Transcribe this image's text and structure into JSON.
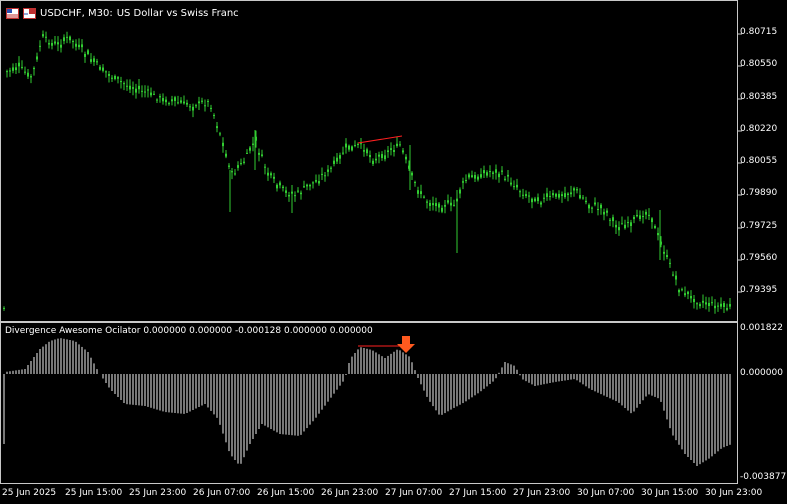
{
  "header": {
    "symbol_label": "USDCHF, M30:",
    "description": "US Dollar vs Swiss Franc",
    "icons": [
      "flag-icon",
      "chart-type-icon"
    ]
  },
  "price_axis": {
    "labels": [
      "0.80715",
      "0.80550",
      "0.80385",
      "0.80220",
      "0.80055",
      "0.79890",
      "0.79725",
      "0.79560",
      "0.79395"
    ]
  },
  "indicator": {
    "title": "Divergence Awesome Ocilator 0.000000 0.000000 -0.000128 0.000000 0.000000",
    "axis_labels": [
      "0.001822",
      "0.000000",
      "-0.003877"
    ]
  },
  "time_axis": {
    "labels": [
      "25 Jun 2025",
      "25 Jun 15:00",
      "25 Jun 23:00",
      "26 Jun 07:00",
      "26 Jun 15:00",
      "26 Jun 23:00",
      "27 Jun 07:00",
      "27 Jun 15:00",
      "27 Jun 23:00",
      "30 Jun 07:00",
      "30 Jun 15:00",
      "30 Jun 23:00"
    ]
  },
  "colors": {
    "background": "#000000",
    "candle": "#32cd32",
    "histogram": "#a0a0a0",
    "divergence_line": "#ff2020",
    "arrow": "#ff5a1f",
    "grid_border": "#c8c8c8"
  }
}
